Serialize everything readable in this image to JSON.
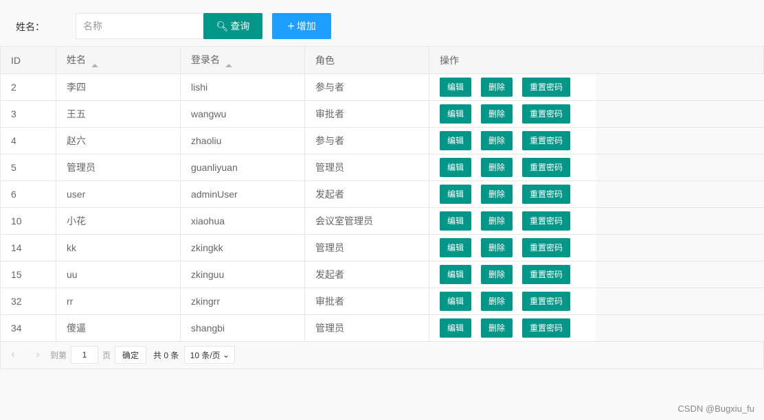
{
  "search": {
    "label": "姓名：",
    "placeholder": "名称",
    "query": "查询",
    "add": "增加"
  },
  "columns": [
    "ID",
    "姓名",
    "登录名",
    "角色",
    "操作"
  ],
  "actions": {
    "edit": "编辑",
    "delete": "删除",
    "reset": "重置密码"
  },
  "rows": [
    [
      "2",
      "李四",
      "lishi",
      "参与者"
    ],
    [
      "3",
      "王五",
      "wangwu",
      "审批者"
    ],
    [
      "4",
      "赵六",
      "zhaoliu",
      "参与者"
    ],
    [
      "5",
      "管理员",
      "guanliyuan",
      "管理员"
    ],
    [
      "6",
      "user",
      "adminUser",
      "发起者"
    ],
    [
      "10",
      "小花",
      "xiaohua",
      "会议室管理员"
    ],
    [
      "14",
      "kk",
      "zkingkk",
      "管理员"
    ],
    [
      "15",
      "uu",
      "zkinguu",
      "发起者"
    ],
    [
      "32",
      "rr",
      "zkingrr",
      "审批者"
    ],
    [
      "34",
      "傻逼",
      "shangbi",
      "管理员"
    ]
  ],
  "pager": {
    "goto": "到第",
    "page": "1",
    "page_unit": "页",
    "confirm": "确定",
    "total": "共 0 条",
    "per_page": "10 条/页"
  },
  "watermark": "CSDN @Bugxiu_fu"
}
